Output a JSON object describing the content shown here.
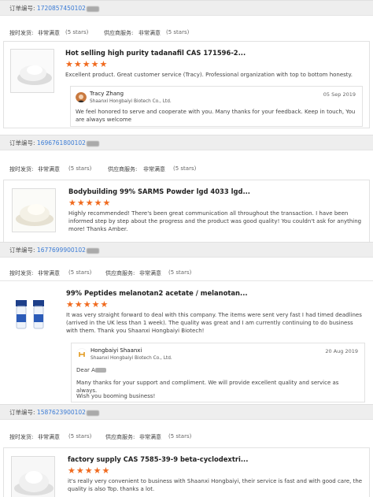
{
  "order_prefix": "订单编号:",
  "ratings_labels": {
    "delivery": "按时发货:",
    "service": "供应商服务:",
    "very_satisfied": "非常满意",
    "five_stars": "(5 stars)"
  },
  "orders": [
    {
      "number": "1720857450102",
      "product_title": "Hot selling high purity tadanafil CAS 171596-2...",
      "stars": "★★★★★",
      "review": "Excellent product. Great customer service (Tracy). Professional organization with top to bottom honesty.",
      "reply": {
        "name": "Tracy Zhang",
        "company": "Shaanxi Hongbaiyi Biotech Co., Ltd.",
        "date": "05 Sep 2019",
        "text": "We feel honored to serve and cooperate with you. Many thanks for your feedback. Keep in touch, You are always welcome"
      }
    },
    {
      "number": "1696761800102",
      "product_title": "Bodybuilding 99% SARMS Powder lgd 4033 lgd...",
      "stars": "★★★★★",
      "review": "Highly recommended! There's been great communication all throughout the transaction. I have been informed step by step about the progress and the product was good quality! You couldn't ask for anything more! Thanks Amber."
    },
    {
      "number": "1677699900102",
      "product_title": "99% Peptides melanotan2 acetate / melanotan...",
      "stars": "★★★★★",
      "review": "It was very straight forward to deal with this company. The items were sent very fast I had timed deadlines (arrived in the UK less than 1 week). The quality was great and I am currently continuing to do business with them. Thank you Shaanxi Hongbaiyi Biotech!",
      "reply": {
        "name": "Hongbaiyi Shaanxi",
        "company": "Shaanxi Hongbaiyi Biotech Co., Ltd.",
        "date": "20 Aug 2019",
        "greeting": "Dear A",
        "text": "Many thanks for your support and compliment. We will provide excellent quality and service as always.",
        "closing": "Wish you booming business!"
      }
    },
    {
      "number": "1587623900102",
      "product_title": "factory supply CAS 7585-39-9 beta-cyclodextri...",
      "stars": "★★★★★",
      "review": "it's really very convenient to business with Shaanxi Hongbaiyi, their service is fast and with good care, the quality is also Top. thanks a lot."
    }
  ],
  "colors": {
    "star": "#f06a1e",
    "order_number": "#3a7bd5",
    "bar_bg": "#eeeeee"
  }
}
